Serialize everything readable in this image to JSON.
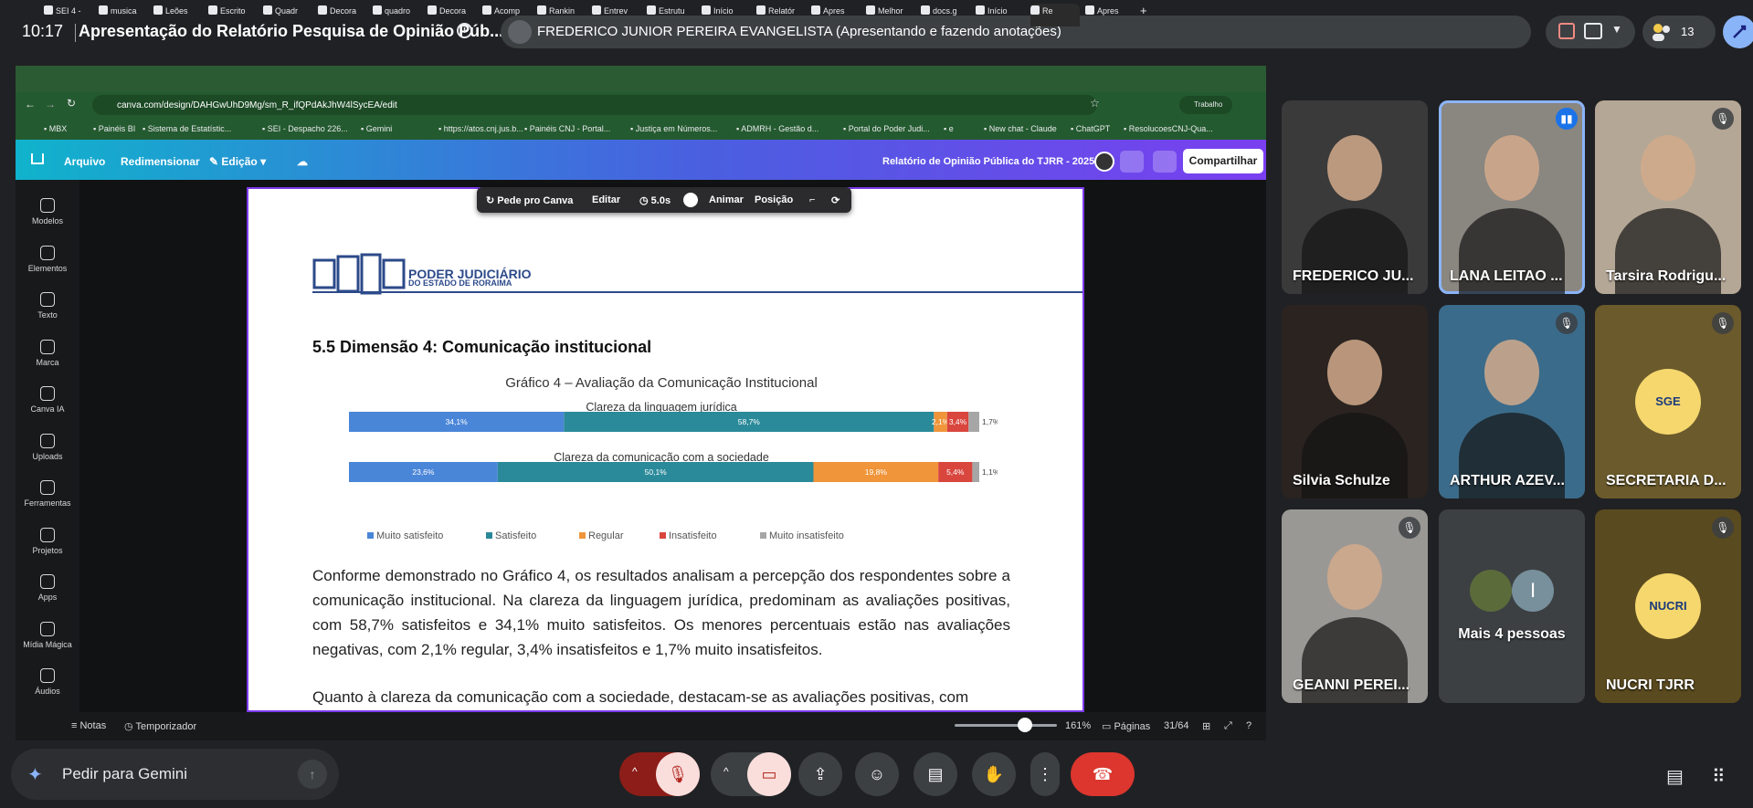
{
  "meet": {
    "time": "10:17",
    "title": "Apresentação do Relatório Pesquisa de Opinião Púb...",
    "presenter": "FREDERICO JUNIOR PEREIRA EVANGELISTA (Apresentando e fazendo anotações)",
    "people_count": "13",
    "gemini_placeholder": "Pedir para Gemini"
  },
  "browser": {
    "tabs": [
      "SEI 4 -",
      "musica",
      "Leões",
      "Escrito",
      "Quadr",
      "Decora",
      "quadro",
      "Decora",
      "Acomp",
      "Rankin",
      "Entrev",
      "Estrutu",
      "Início",
      "Relatór",
      "Apres",
      "Melhor",
      "docs.g",
      "Início",
      "Re",
      "Apres"
    ],
    "url": "canva.com/design/DAHGwUhD9Mg/sm_R_ifQPdAkJhW4lSycEA/edit",
    "bookmarks": [
      "MBX",
      "Painéis BI",
      "Sistema de Estatístic...",
      "SEI - Despacho 226...",
      "Gemini",
      "https://atos.cnj.jus.b...",
      "Painéis CNJ - Portal...",
      "Justiça em Números...",
      "ADMRH - Gestão d...",
      "Portal do Poder Judi...",
      "e",
      "New chat - Claude",
      "ChatGPT",
      "ResolucoesCNJ-Qua..."
    ],
    "profile": "Trabalho"
  },
  "canva": {
    "menu": {
      "file": "Arquivo",
      "resize": "Redimensionar",
      "edit": "Edição"
    },
    "doc_title": "Relatório de Opinião Pública do TJRR - 2025",
    "share": "Compartilhar",
    "rail": [
      "Modelos",
      "Elementos",
      "Texto",
      "Marca",
      "Canva IA",
      "Uploads",
      "Ferramentas",
      "Projetos",
      "Apps",
      "Mídia Mágica",
      "Áudios"
    ],
    "floatbar": {
      "ask": "Pede pro Canva",
      "edit": "Editar",
      "duration": "5.0s",
      "animate": "Animar",
      "position": "Posição"
    },
    "status": {
      "notes": "Notas",
      "timer": "Temporizador",
      "zoom": "161%",
      "pages_label": "Páginas",
      "pages": "31/64"
    }
  },
  "page": {
    "logo_line1": "PODER JUDICIÁRIO",
    "logo_line2": "DO ESTADO DE RORAIMA",
    "section_title": "5.5 Dimensão 4: Comunicação institucional",
    "paragraph1": "Conforme demonstrado no Gráfico 4, os resultados analisam a percepção dos respondentes sobre a comunicação institucional. Na clareza da linguagem jurídica, predominam as avaliações positivas, com 58,7% satisfeitos e 34,1% muito satisfeitos. Os menores percentuais estão nas avaliações negativas, com 2,1% regular, 3,4% insatisfeitos e 1,7% muito insatisfeitos.",
    "paragraph2": "Quanto à clareza da comunicação com a sociedade, destacam-se as avaliações positivas, com"
  },
  "chart_data": {
    "type": "bar",
    "orientation": "horizontal-stacked-100",
    "title": "Gráfico 4 – Avaliação da Comunicação Institucional",
    "categories": [
      "Clareza da linguagem jurídica",
      "Clareza da comunicação com a sociedade"
    ],
    "series": [
      {
        "name": "Muito satisfeito",
        "color": "#4a86d8",
        "values": [
          34.1,
          23.6
        ],
        "labels": [
          "34,1%",
          "23,6%"
        ]
      },
      {
        "name": "Satisfeito",
        "color": "#2a8a9a",
        "values": [
          58.7,
          50.1
        ],
        "labels": [
          "58,7%",
          "50,1%"
        ]
      },
      {
        "name": "Regular",
        "color": "#f0953a",
        "values": [
          2.1,
          19.8
        ],
        "labels": [
          "2,1%",
          "19,8%"
        ]
      },
      {
        "name": "Insatisfeito",
        "color": "#d9463e",
        "values": [
          3.4,
          5.4
        ],
        "labels": [
          "3,4%",
          "5,4%"
        ]
      },
      {
        "name": "Muito insatisfeito",
        "color": "#a6a6a6",
        "values": [
          1.7,
          1.1
        ],
        "labels": [
          "1,7%",
          "1,1%"
        ]
      }
    ],
    "legend": "bottom"
  },
  "participants": [
    {
      "name": "FREDERICO JU...",
      "bg": "#3a3a3a",
      "muted": false
    },
    {
      "name": "LANA LEITAO ...",
      "bg": "#8a8680",
      "speaking": true
    },
    {
      "name": "Tarsira Rodrigu...",
      "bg": "#b5a796",
      "muted": true
    },
    {
      "name": "Silvia Schulze",
      "bg": "#2a2320",
      "muted": false
    },
    {
      "name": "ARTHUR AZEV...",
      "bg": "#3b6b8a",
      "muted": true
    },
    {
      "name": "SECRETARIA D...",
      "bg": "#6b5a2b",
      "muted": true,
      "avatar": "SGE"
    },
    {
      "name": "GEANNI PEREI...",
      "bg": "#9a9894",
      "muted": true
    },
    {
      "name": "Mais 4 pessoas",
      "bg": "#3c4043",
      "avatar": "I"
    },
    {
      "name": "NUCRI TJRR",
      "bg": "#5a4a1f",
      "muted": true,
      "avatar": "NUCRI"
    }
  ],
  "icons": {
    "info": "info-icon",
    "present": "present-icon",
    "mic_off": "mic-off-icon",
    "cam_off": "camera-off-icon",
    "emoji": "emoji-icon",
    "captions": "captions-icon",
    "hand": "raise-hand-icon",
    "more": "more-icon",
    "leave": "leave-call-icon",
    "chat": "chat-icon",
    "apps": "apps-icon"
  }
}
